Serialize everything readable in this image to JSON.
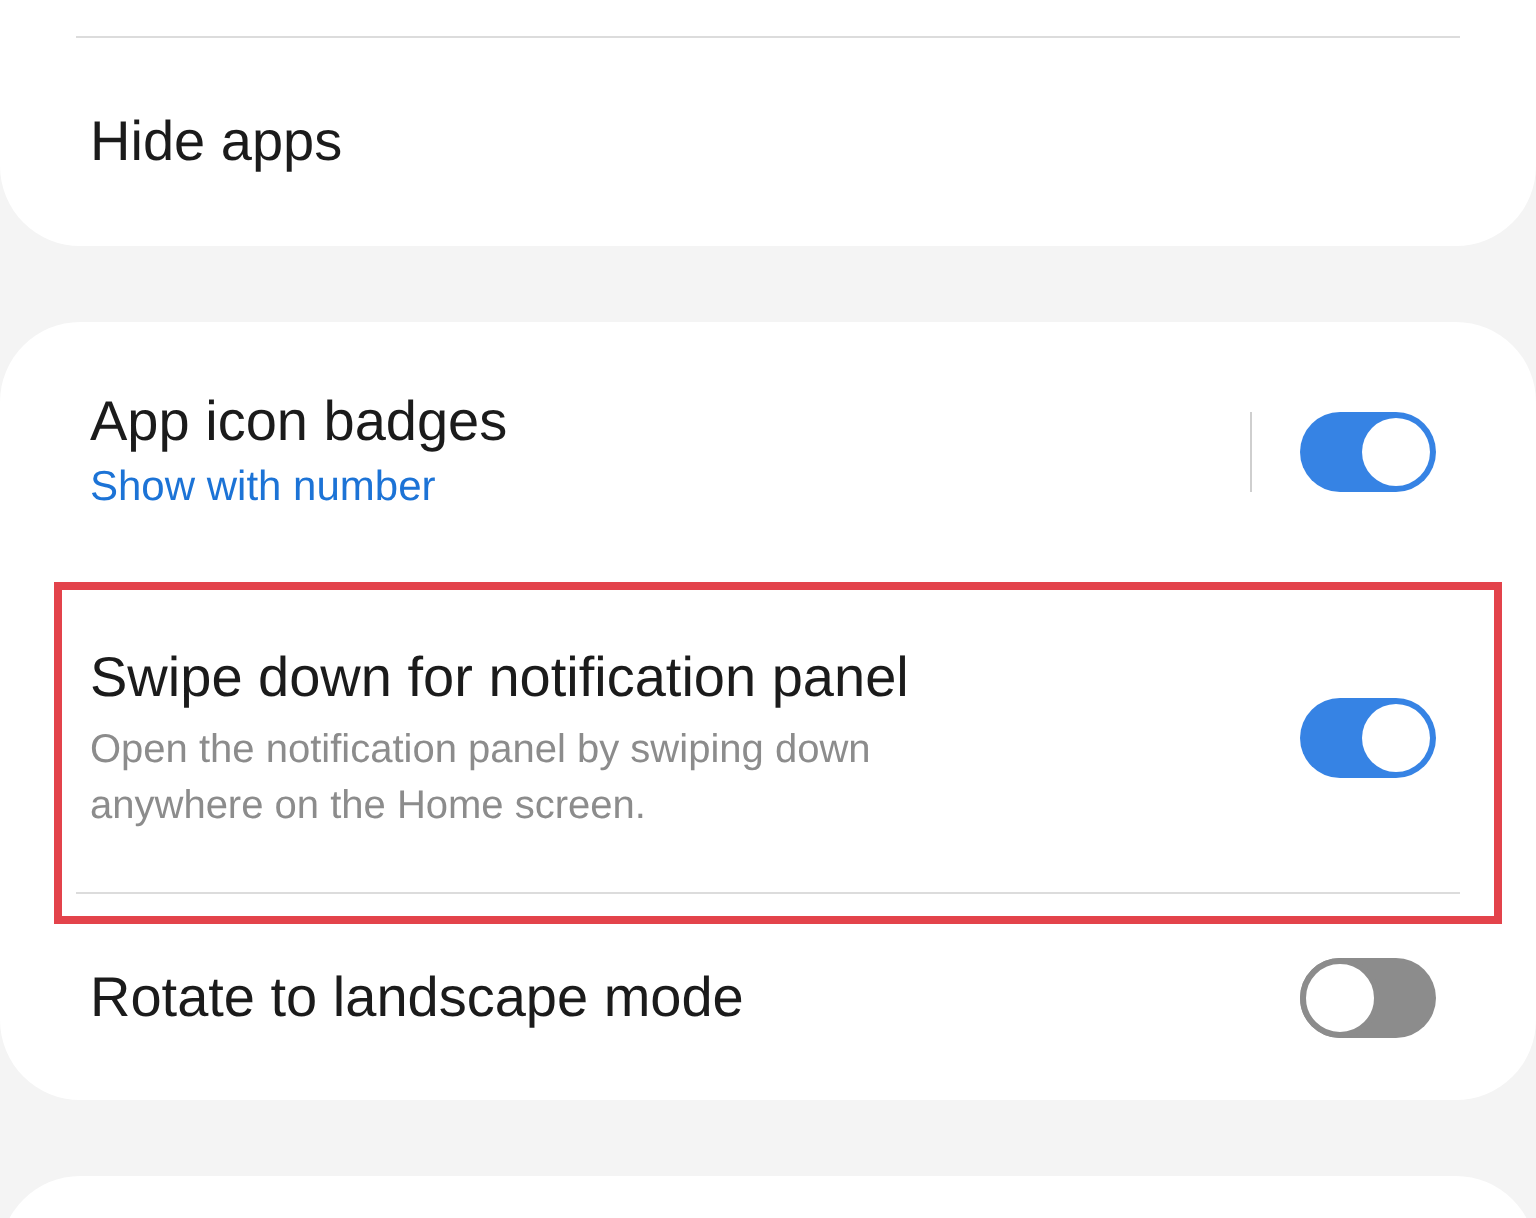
{
  "top_card": {
    "items": [
      {
        "title": "Hide apps"
      }
    ]
  },
  "settings": [
    {
      "kind": "split_toggle",
      "title": "App icon badges",
      "value": "Show with number",
      "on": true,
      "highlighted": false
    },
    {
      "kind": "toggle",
      "title": "Swipe down for notification panel",
      "description": "Open the notification panel by swiping down anywhere on the Home screen.",
      "on": true,
      "highlighted": true
    },
    {
      "kind": "toggle",
      "title": "Rotate to landscape mode",
      "on": false,
      "highlighted": false
    }
  ]
}
